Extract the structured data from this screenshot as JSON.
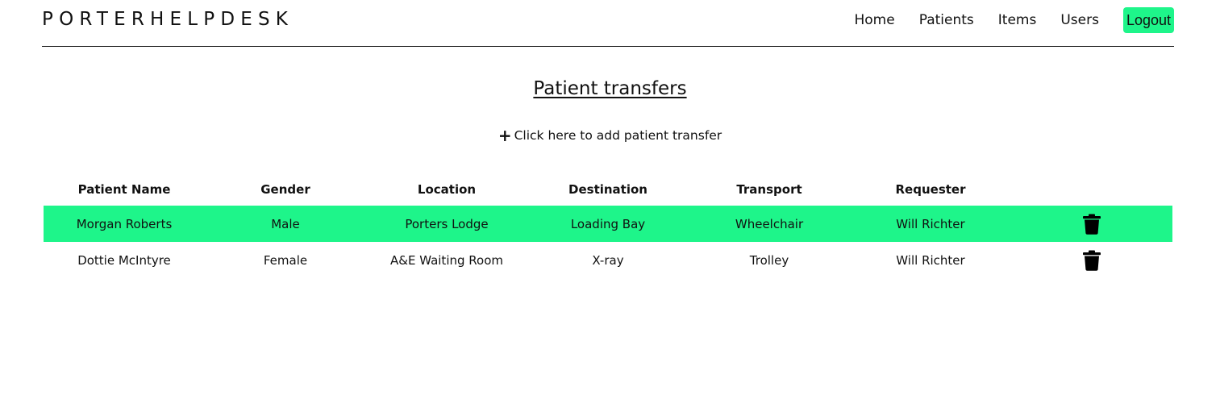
{
  "nav": {
    "brand": "PORTERHELPDESK",
    "links": [
      {
        "label": "Home"
      },
      {
        "label": "Patients"
      },
      {
        "label": "Items"
      },
      {
        "label": "Users"
      }
    ],
    "logout_label": "Logout",
    "accent_color": "#1ef58a"
  },
  "page": {
    "title": "Patient transfers",
    "add_icon": "plus-icon",
    "add_label": "Click here to add patient transfer"
  },
  "table": {
    "columns": [
      "Patient Name",
      "Gender",
      "Location",
      "Destination",
      "Transport",
      "Requester",
      ""
    ],
    "rows": [
      {
        "patient_name": "Morgan Roberts",
        "gender": "Male",
        "location": "Porters Lodge",
        "destination": "Loading Bay",
        "transport": "Wheelchair",
        "requester": "Will Richter",
        "action_icon": "trash-icon",
        "highlighted": true
      },
      {
        "patient_name": "Dottie McIntyre",
        "gender": "Female",
        "location": "A&E Waiting Room",
        "destination": "X-ray",
        "transport": "Trolley",
        "requester": "Will Richter",
        "action_icon": "trash-icon",
        "highlighted": false
      }
    ],
    "highlight_color": "#1ef58a"
  }
}
